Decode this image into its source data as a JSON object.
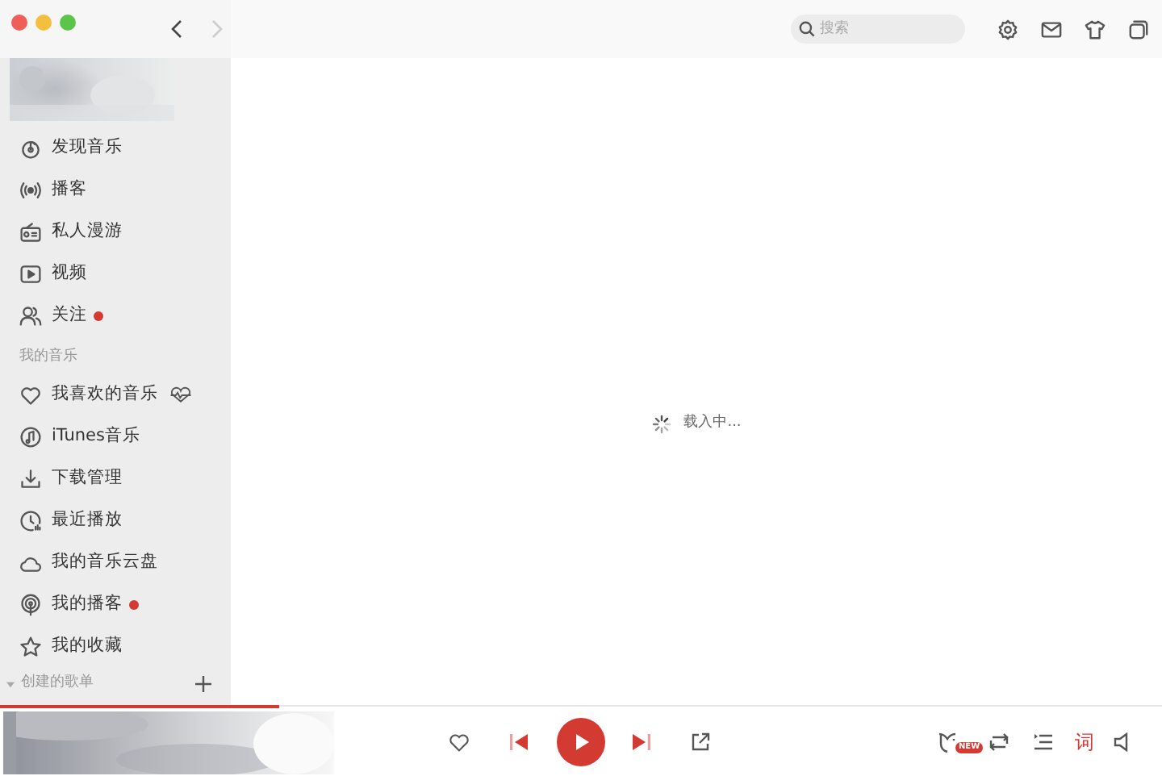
{
  "window": {
    "back_enabled": true,
    "forward_enabled": false
  },
  "search": {
    "placeholder": "搜索"
  },
  "sidebar": {
    "items": [
      {
        "label": "发现音乐",
        "selected": false,
        "dot": false
      },
      {
        "label": "播客",
        "selected": false,
        "dot": false
      },
      {
        "label": "私人漫游",
        "selected": false,
        "dot": false
      },
      {
        "label": "视频",
        "selected": false,
        "dot": false
      },
      {
        "label": "关注",
        "selected": false,
        "dot": true
      }
    ],
    "my_music": {
      "title": "我的音乐",
      "items": [
        {
          "label": "我喜欢的音乐",
          "selected": false,
          "dot": false,
          "heartbeat": true
        },
        {
          "label": "iTunes音乐",
          "selected": false,
          "dot": false,
          "heartbeat": false
        },
        {
          "label": "下载管理",
          "selected": false,
          "dot": false,
          "heartbeat": false
        },
        {
          "label": "最近播放",
          "selected": false,
          "dot": false,
          "heartbeat": false
        },
        {
          "label": "我的音乐云盘",
          "selected": false,
          "dot": false,
          "heartbeat": false
        },
        {
          "label": "我的播客",
          "selected": false,
          "dot": true,
          "heartbeat": false
        },
        {
          "label": "我的收藏",
          "selected": false,
          "dot": false,
          "heartbeat": false
        }
      ]
    },
    "playlists": {
      "title": "创建的歌单",
      "expanded": true
    }
  },
  "content": {
    "loading_text": "载入中..."
  },
  "player": {
    "progress": {
      "level": 0.24
    },
    "liked": false,
    "mode_badge": "NEW",
    "lyrics_label": "词"
  }
}
